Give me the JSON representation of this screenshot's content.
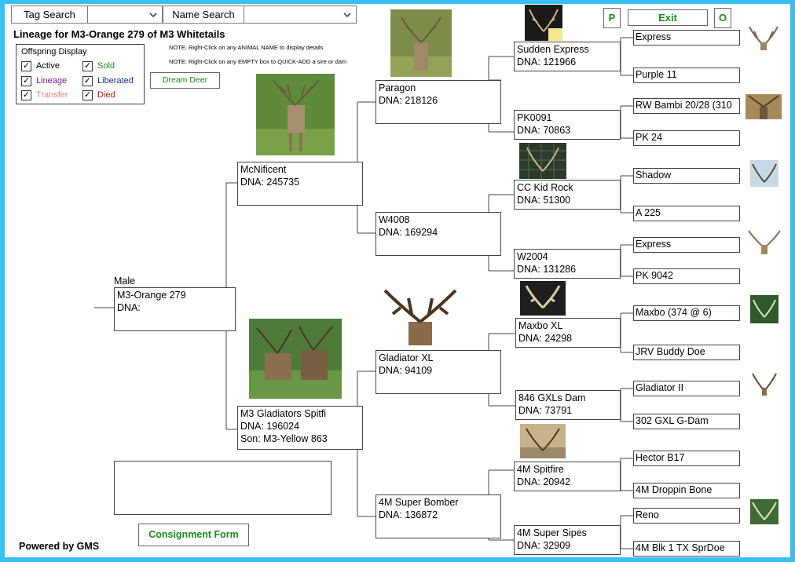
{
  "search": {
    "tag_label": "Tag Search",
    "name_label": "Name Search",
    "tag_value": "",
    "name_value": ""
  },
  "header": {
    "title": "Lineage for M3-Orange 279 of M3 Whitetails",
    "note1": "NOTE: Right-Click on any ANIMAL NAME to display details",
    "note2": "NOTE: Right-Click on any EMPTY box to QUICK-ADD a sire or dam"
  },
  "offspring": {
    "title": "Offspring Display",
    "items": [
      {
        "label": "Active",
        "color": "#000000",
        "checked": true
      },
      {
        "label": "Sold",
        "color": "#1a8a1a",
        "checked": true
      },
      {
        "label": "Lineage",
        "color": "#7a1a9a",
        "checked": true
      },
      {
        "label": "Liberated",
        "color": "#1a2a9a",
        "checked": true
      },
      {
        "label": "Transfer",
        "color": "#e08080",
        "checked": true
      },
      {
        "label": "Died",
        "color": "#b01010",
        "checked": true
      }
    ]
  },
  "buttons": {
    "dream": "Dream Deer",
    "p": "P",
    "exit": "Exit",
    "o": "O",
    "consignment": "Consignment Form"
  },
  "footer": {
    "powered": "Powered by GMS"
  },
  "subject": {
    "sex": "Male",
    "name": "M3-Orange 279",
    "dna": "DNA:"
  },
  "gen1": {
    "sire": {
      "name": "McNificent",
      "dna": "DNA:  245735"
    },
    "dam": {
      "name": "M3 Gladiators Spitfi",
      "dna": "DNA:  196024",
      "son": "Son: M3-Yellow 863"
    }
  },
  "gen2": [
    {
      "name": "Paragon",
      "dna": "DNA:  218126"
    },
    {
      "name": "W4008",
      "dna": "DNA:  169294"
    },
    {
      "name": "Gladiator XL",
      "dna": "DNA:  94109"
    },
    {
      "name": "4M Super Bomber",
      "dna": "DNA:  136872"
    }
  ],
  "gen3": [
    {
      "name": "Sudden Express",
      "dna": "DNA:  121966"
    },
    {
      "name": "PK0091",
      "dna": "DNA:  70863"
    },
    {
      "name": "CC Kid Rock",
      "dna": "DNA:  51300"
    },
    {
      "name": "W2004",
      "dna": "DNA:  131286"
    },
    {
      "name": "Maxbo XL",
      "dna": "DNA:  24298"
    },
    {
      "name": "846 GXLs Dam",
      "dna": "DNA:  73791"
    },
    {
      "name": "4M Spitfire",
      "dna": "DNA:  20942"
    },
    {
      "name": "4M Super Sipes",
      "dna": "DNA:  32909"
    }
  ],
  "gen4": [
    "Express",
    "Purple 11",
    "RW Bambi 20/28 (310",
    "PK 24",
    "Shadow",
    "A 225",
    "Express",
    "PK 9042",
    "Maxbo (374 @ 6)",
    "JRV Buddy Doe",
    "Gladiator II",
    "302 GXL G-Dam",
    "Hector B17",
    "4M Droppin Bone",
    "Reno",
    "4M Blk 1 TX SprDoe"
  ]
}
